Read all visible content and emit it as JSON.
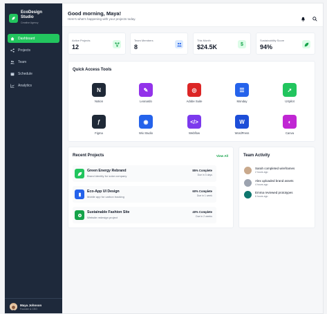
{
  "sidebar": {
    "brand_title_1": "EcoDesign",
    "brand_title_2": "Studio",
    "brand_sub": "Creative Agency",
    "items": [
      {
        "label": "Dashboard",
        "icon": "home-icon"
      },
      {
        "label": "Projects",
        "icon": "projects-icon"
      },
      {
        "label": "Team",
        "icon": "team-icon"
      },
      {
        "label": "Schedule",
        "icon": "calendar-icon"
      },
      {
        "label": "Analytics",
        "icon": "chart-icon"
      }
    ],
    "user": {
      "name": "Maya Johnson",
      "role": "Founder & CEO"
    }
  },
  "header": {
    "greeting": "Good morning, Maya!",
    "subtitle": "Here's what's happening with your projects today."
  },
  "stats": [
    {
      "label": "Active Projects",
      "value": "12",
      "icon": "network-icon",
      "color": "#16a34a",
      "bg": "#dcfce7"
    },
    {
      "label": "Team Members",
      "value": "8",
      "icon": "users-icon",
      "color": "#2563eb",
      "bg": "#dbeafe"
    },
    {
      "label": "This Month",
      "value": "$24.5K",
      "icon": "dollar-icon",
      "color": "#16a34a",
      "bg": "#dcfce7"
    },
    {
      "label": "Sustainability Score",
      "value": "94%",
      "icon": "leaf-icon",
      "color": "#16a34a",
      "bg": "#dcfce7"
    }
  ],
  "tools": {
    "title": "Quick Access Tools",
    "items": [
      {
        "label": "Notion",
        "color": "#1f2937",
        "glyph": "N"
      },
      {
        "label": "Leonardo",
        "color": "#9333ea",
        "glyph": "✎"
      },
      {
        "label": "Adobe Suite",
        "color": "#dc2626",
        "glyph": "◎"
      },
      {
        "label": "Monday",
        "color": "#2563eb",
        "glyph": "☰"
      },
      {
        "label": "UXpilot",
        "color": "#22c55e",
        "glyph": "➚"
      },
      {
        "label": "Figma",
        "color": "#1f2937",
        "glyph": "ƒ"
      },
      {
        "label": "Wix Studio",
        "color": "#2563eb",
        "glyph": "◉"
      },
      {
        "label": "Webflow",
        "color": "#7c3aed",
        "glyph": "</>"
      },
      {
        "label": "WordPress",
        "color": "#1d4ed8",
        "glyph": "W"
      },
      {
        "label": "Canva",
        "color": "#c026d3",
        "glyph": "◐"
      }
    ]
  },
  "projects": {
    "title": "Recent Projects",
    "view_all": "View All",
    "items": [
      {
        "name": "Green Energy Rebrand",
        "desc": "Brand identity for solar company",
        "progress_text": "85% Complete",
        "progress": 85,
        "due": "Due in 3 days",
        "color": "#22c55e"
      },
      {
        "name": "Eco-App UI Design",
        "desc": "Mobile app for carbon tracking",
        "progress_text": "60% Complete",
        "progress": 60,
        "due": "Due in 1 week",
        "color": "#2563eb"
      },
      {
        "name": "Sustainable Fashion Site",
        "desc": "Website redesign project",
        "progress_text": "40% Complete",
        "progress": 40,
        "due": "Due in 2 weeks",
        "color": "#16a34a"
      }
    ]
  },
  "activity": {
    "title": "Team Activity",
    "items": [
      {
        "text": "Sarah completed wireframes",
        "time": "2 hours ago",
        "color": "#c9a98c"
      },
      {
        "text": "Alex uploaded brand assets",
        "time": "4 hours ago",
        "color": "#9ca3af"
      },
      {
        "text": "Emma reviewed prototypes",
        "time": "6 hours ago",
        "color": "#0f766e"
      }
    ]
  }
}
